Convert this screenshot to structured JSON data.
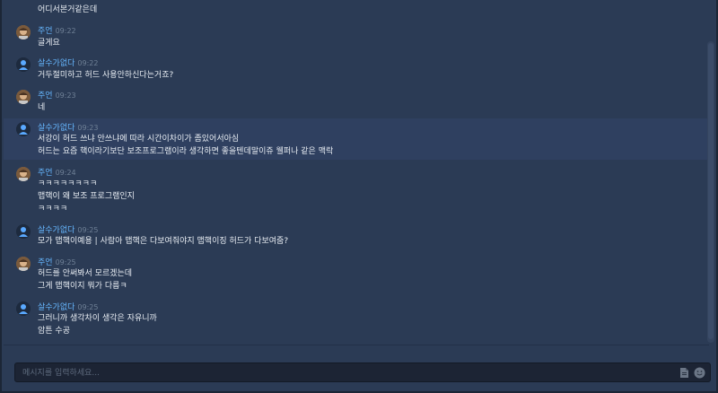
{
  "messages": [
    {
      "user": "",
      "time": "",
      "lines": [
        "어디서본거같은데"
      ],
      "avatar": "none",
      "highlight": false
    },
    {
      "user": "주언",
      "time": "09:22",
      "lines": [
        "글게요"
      ],
      "avatar": "jooeon",
      "highlight": false
    },
    {
      "user": "살수가없다",
      "time": "09:22",
      "lines": [
        "거두절미하고 허드 사용안하신다는거죠?"
      ],
      "avatar": "user",
      "highlight": false
    },
    {
      "user": "주언",
      "time": "09:23",
      "lines": [
        "네"
      ],
      "avatar": "jooeon",
      "highlight": false
    },
    {
      "user": "살수가없다",
      "time": "09:23",
      "lines": [
        "서강이 허드 쓰냐 안쓰냐에 따라 시간이차이가 좀있어서아심",
        "허드는 요즘 핵이라기보단 보조프로그램이라 생각하면 좋을텐데말이쥬 웰퍼나 같은 맥락"
      ],
      "avatar": "user",
      "highlight": true
    },
    {
      "user": "주언",
      "time": "09:24",
      "lines": [
        "ㅋㅋㅋㅋㅋㅋㅋㅋ",
        "맵핵이 왜 보조 프로그램인지",
        "ㅋㅋㅋㅋ"
      ],
      "avatar": "jooeon",
      "highlight": false
    },
    {
      "user": "살수가없다",
      "time": "09:25",
      "lines": [
        "모가 맵핵이예용  | 사람아 맵핵은 다보여줘야지 맵핵이징 허드가 다보여줌?"
      ],
      "avatar": "user",
      "highlight": false
    },
    {
      "user": "주언",
      "time": "09:25",
      "lines": [
        "허드를 안써봐서 모르겠는데",
        "그게 맵핵이지 뭐가 다름ㅋ"
      ],
      "avatar": "jooeon",
      "highlight": false
    },
    {
      "user": "살수가없다",
      "time": "09:25",
      "lines": [
        "그러니까 생각차이 생각은 자유니까",
        "암튼 수공"
      ],
      "avatar": "user",
      "highlight": false
    }
  ],
  "input": {
    "placeholder": "메시지를 입력하세요..."
  },
  "icons": {
    "file": "file-icon",
    "emoji": "emoji-icon"
  },
  "colors": {
    "background": "#2b3b55",
    "username": "#66b7ff",
    "timestamp": "#6f8096"
  }
}
